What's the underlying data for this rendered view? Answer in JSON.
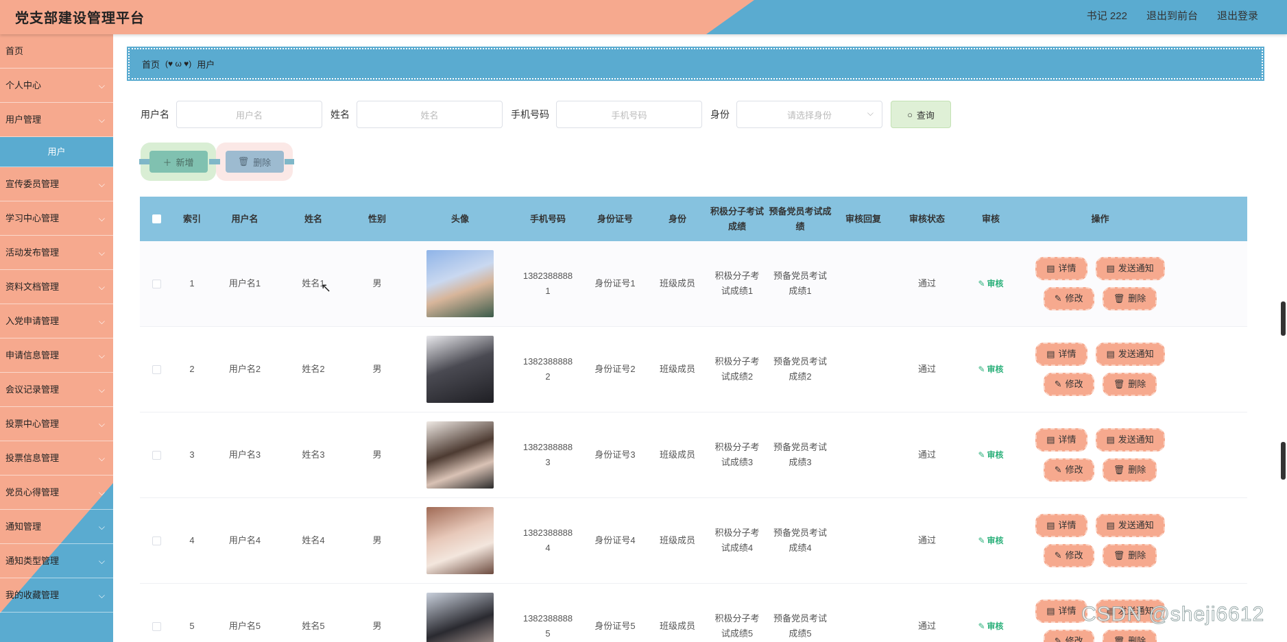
{
  "header": {
    "title": "党支部建设管理平台",
    "user": "书记 222",
    "to_front": "退出到前台",
    "logout": "退出登录"
  },
  "sidebar": {
    "items": [
      {
        "label": "首页",
        "chevron": false
      },
      {
        "label": "个人中心",
        "chevron": true
      },
      {
        "label": "用户管理",
        "chevron": true
      },
      {
        "label": "用户",
        "sub": true,
        "active": true
      },
      {
        "label": "宣传委员管理",
        "chevron": true
      },
      {
        "label": "学习中心管理",
        "chevron": true
      },
      {
        "label": "活动发布管理",
        "chevron": true
      },
      {
        "label": "资料文档管理",
        "chevron": true
      },
      {
        "label": "入党申请管理",
        "chevron": true
      },
      {
        "label": "申请信息管理",
        "chevron": true
      },
      {
        "label": "会议记录管理",
        "chevron": true
      },
      {
        "label": "投票中心管理",
        "chevron": true
      },
      {
        "label": "投票信息管理",
        "chevron": true
      },
      {
        "label": "党员心得管理",
        "chevron": true
      },
      {
        "label": "通知管理",
        "chevron": true
      },
      {
        "label": "通知类型管理",
        "chevron": true
      },
      {
        "label": "我的收藏管理",
        "chevron": true
      }
    ]
  },
  "breadcrumb": {
    "home": "首页",
    "sep": "(♥ ω ♥)",
    "current": "用户"
  },
  "search": {
    "username_label": "用户名",
    "username_placeholder": "用户名",
    "name_label": "姓名",
    "name_placeholder": "姓名",
    "phone_label": "手机号码",
    "phone_placeholder": "手机号码",
    "role_label": "身份",
    "role_placeholder": "请选择身份",
    "query": "查询"
  },
  "actions": {
    "add": "新增",
    "delete": "删除"
  },
  "table": {
    "columns": [
      "索引",
      "用户名",
      "姓名",
      "性别",
      "头像",
      "手机号码",
      "身份证号",
      "身份",
      "积极分子考试成绩",
      "预备党员考试成绩",
      "审核回复",
      "审核状态",
      "审核",
      "操作"
    ],
    "review_label": "审核",
    "op_detail": "详情",
    "op_notify": "发送通知",
    "op_edit": "修改",
    "op_delete": "删除",
    "rows": [
      {
        "index": "1",
        "username": "用户名1",
        "name": "姓名1",
        "gender": "男",
        "phone": "13823888881",
        "idcard": "身份证号1",
        "role": "班级成员",
        "score1": "积极分子考试成绩1",
        "score2": "预备党员考试成绩1",
        "reply": "",
        "status": "通过"
      },
      {
        "index": "2",
        "username": "用户名2",
        "name": "姓名2",
        "gender": "男",
        "phone": "13823888882",
        "idcard": "身份证号2",
        "role": "班级成员",
        "score1": "积极分子考试成绩2",
        "score2": "预备党员考试成绩2",
        "reply": "",
        "status": "通过"
      },
      {
        "index": "3",
        "username": "用户名3",
        "name": "姓名3",
        "gender": "男",
        "phone": "13823888883",
        "idcard": "身份证号3",
        "role": "班级成员",
        "score1": "积极分子考试成绩3",
        "score2": "预备党员考试成绩3",
        "reply": "",
        "status": "通过"
      },
      {
        "index": "4",
        "username": "用户名4",
        "name": "姓名4",
        "gender": "男",
        "phone": "13823888884",
        "idcard": "身份证号4",
        "role": "班级成员",
        "score1": "积极分子考试成绩4",
        "score2": "预备党员考试成绩4",
        "reply": "",
        "status": "通过"
      },
      {
        "index": "5",
        "username": "用户名5",
        "name": "姓名5",
        "gender": "男",
        "phone": "13823888885",
        "idcard": "身份证号5",
        "role": "班级成员",
        "score1": "积极分子考试成绩5",
        "score2": "预备党员考试成绩5",
        "reply": "",
        "status": "通过"
      }
    ]
  },
  "watermark": "CSDN @sheji6612",
  "colors": {
    "salmon": "#f6a98e",
    "blue": "#5aabd0",
    "header_blue": "#86c2df",
    "green_review": "#2bb07a"
  }
}
